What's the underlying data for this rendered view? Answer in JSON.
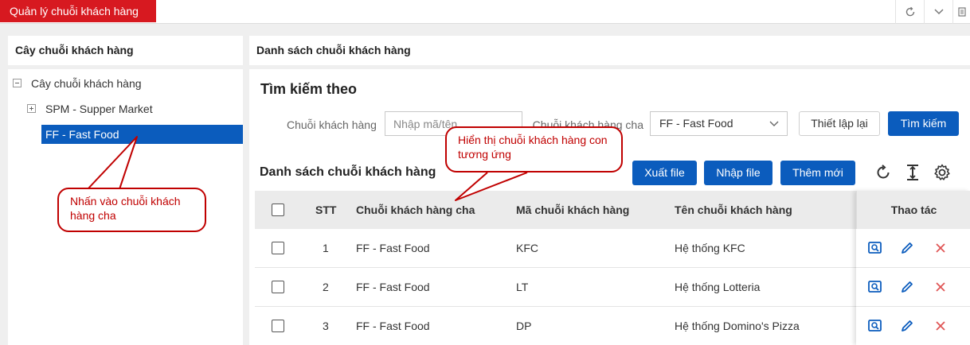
{
  "app": {
    "title": "Quản lý chuỗi khách hàng"
  },
  "left": {
    "header": "Cây chuỗi khách hàng",
    "tree": {
      "root": "Cây chuỗi khách hàng",
      "items": [
        "SPM - Supper Market",
        "FF - Fast Food"
      ]
    }
  },
  "right": {
    "header": "Danh sách chuỗi khách hàng",
    "search": {
      "title": "Tìm kiếm theo",
      "chain_label": "Chuỗi khách hàng",
      "chain_placeholder": "Nhập mã/tên",
      "parent_label": "Chuỗi khách hàng cha",
      "parent_value": "FF - Fast Food",
      "reset_label": "Thiết lập lại",
      "search_label": "Tìm kiếm"
    },
    "list": {
      "title": "Danh sách chuỗi khách hàng",
      "export_label": "Xuất file",
      "import_label": "Nhập file",
      "add_label": "Thêm mới",
      "icons": [
        "refresh-icon",
        "column-height-icon",
        "settings-icon"
      ]
    },
    "table": {
      "headers": {
        "stt": "STT",
        "parent": "Chuỗi khách hàng cha",
        "code": "Mã chuỗi khách hàng",
        "name": "Tên chuỗi khách hàng",
        "actions": "Thao tác"
      },
      "rows": [
        {
          "stt": "1",
          "parent": "FF - Fast Food",
          "code": "KFC",
          "name": "Hệ thống KFC"
        },
        {
          "stt": "2",
          "parent": "FF - Fast Food",
          "code": "LT",
          "name": "Hệ thống Lotteria"
        },
        {
          "stt": "3",
          "parent": "FF - Fast Food",
          "code": "DP",
          "name": "Hệ thống Domino's Pizza"
        }
      ],
      "row_action_icons": [
        "view-icon",
        "edit-icon",
        "delete-icon"
      ]
    }
  },
  "callouts": {
    "left": "Nhấn vào chuỗi khách hàng cha",
    "right": "Hiển thị chuỗi khách hàng con tương ứng"
  },
  "colors": {
    "brand_red": "#d71920",
    "primary_blue": "#0b5cbd",
    "callout_red": "#c00000",
    "delete_red": "#e05555"
  }
}
